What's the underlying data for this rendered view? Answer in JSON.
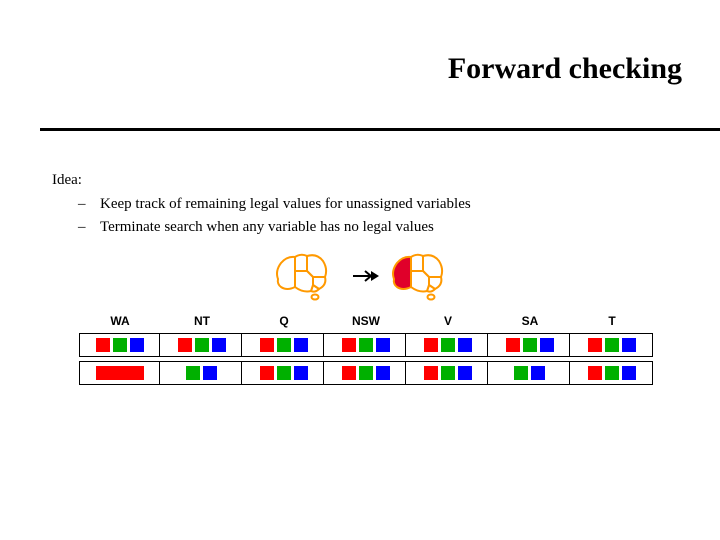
{
  "title": "Forward checking",
  "idea_label": "Idea:",
  "bullets": [
    "Keep track of remaining legal values for unassigned variables",
    "Terminate search when any variable has no legal values"
  ],
  "colors": {
    "red": "#ff0000",
    "green": "#00b000",
    "blue": "#0000ff",
    "map_outline": "#ff9900",
    "map_fill_white": "#ffffff",
    "map_fill_red": "#e0002a"
  },
  "regions": [
    "WA",
    "NT",
    "Q",
    "NSW",
    "V",
    "SA",
    "T"
  ],
  "rows": [
    {
      "cells": [
        [
          "red",
          "green",
          "blue"
        ],
        [
          "red",
          "green",
          "blue"
        ],
        [
          "red",
          "green",
          "blue"
        ],
        [
          "red",
          "green",
          "blue"
        ],
        [
          "red",
          "green",
          "blue"
        ],
        [
          "red",
          "green",
          "blue"
        ],
        [
          "red",
          "green",
          "blue"
        ]
      ]
    },
    {
      "cells": [
        [
          "red-wide"
        ],
        [
          "green",
          "blue"
        ],
        [
          "red",
          "green",
          "blue"
        ],
        [
          "red",
          "green",
          "blue"
        ],
        [
          "red",
          "green",
          "blue"
        ],
        [
          "green",
          "blue"
        ],
        [
          "red",
          "green",
          "blue"
        ]
      ]
    }
  ],
  "maps": {
    "left_highlight": null,
    "right_highlight": "WA"
  }
}
